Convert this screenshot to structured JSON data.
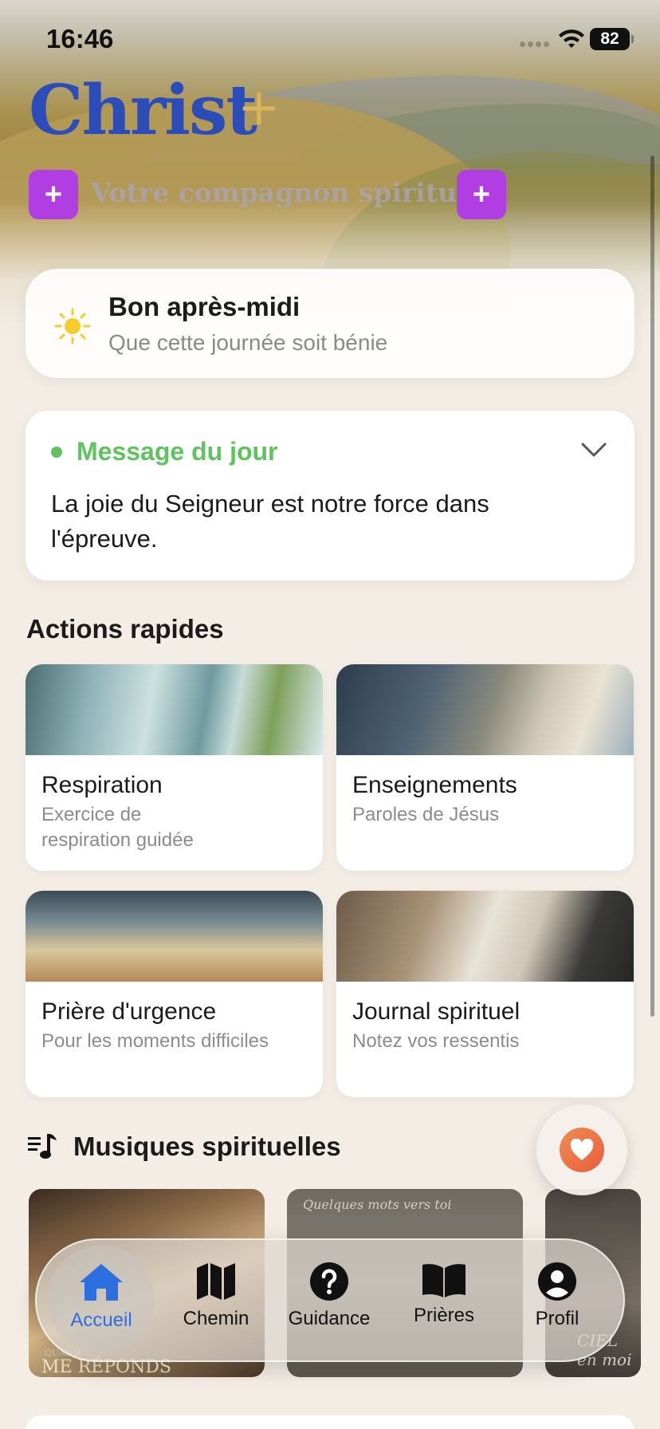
{
  "status_bar": {
    "time": "16:46",
    "battery": "82"
  },
  "header": {
    "logo": "Christ",
    "logo_plus": "+",
    "tagline": "Votre compagnon spirituel",
    "add_left_label": "+",
    "add_right_label": "+"
  },
  "greeting": {
    "title": "Bon après-midi",
    "subtitle": "Que cette journée soit bénie",
    "icon": "sun-icon"
  },
  "message_of_day": {
    "title": "Message du jour",
    "text": "La joie du Seigneur est notre force dans l'épreuve.",
    "accent": "#5fc35f"
  },
  "quick_actions": {
    "title": "Actions rapides",
    "items": [
      {
        "title": "Respiration",
        "subtitle": "Exercice de respiration guidée"
      },
      {
        "title": "Enseignements",
        "subtitle": "Paroles de Jésus"
      },
      {
        "title": "Prière d'urgence",
        "subtitle": "Pour les moments difficiles"
      },
      {
        "title": "Journal spirituel",
        "subtitle": "Notez vos ressentis"
      }
    ]
  },
  "music": {
    "title": "Musiques spirituelles",
    "cards": [
      {
        "caption_small": "QUAND",
        "caption": "ME RÉPONDS"
      },
      {
        "caption": "Quelques mots vers toi"
      },
      {
        "caption": "CIEL en moi"
      }
    ]
  },
  "tabbar": {
    "items": [
      {
        "label": "Accueil",
        "icon": "home-icon",
        "active": true
      },
      {
        "label": "Chemin",
        "icon": "map-icon"
      },
      {
        "label": "Guidance",
        "icon": "question-circle-icon"
      },
      {
        "label": "Prières",
        "icon": "book-icon"
      },
      {
        "label": "Profil",
        "icon": "person-circle-icon"
      }
    ],
    "active_color": "#2d6fe0"
  },
  "colors": {
    "brand": "#2c4db8",
    "purple": "#b13ee2",
    "gold": "#d7b65c",
    "background": "#f3ede6"
  }
}
